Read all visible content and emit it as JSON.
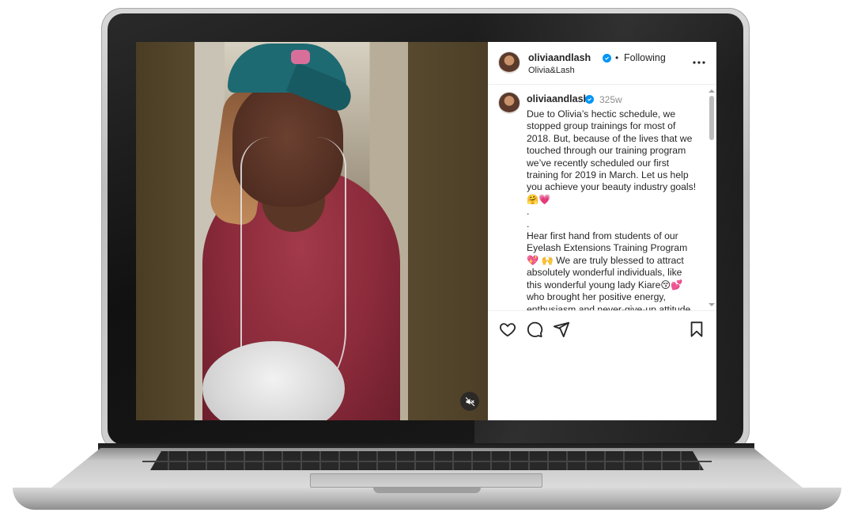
{
  "post": {
    "username": "oliviaandlash",
    "follow_status": "Following",
    "subtitle": "Olivia&Lash",
    "time_ago": "325w",
    "caption": "Due to Olivia’s hectic schedule, we stopped group trainings for most of 2018. But, because of the lives that we touched through our training program we’ve recently scheduled our first training for 2019 in March. Let us help you achieve your beauty industry goals! 🤗💗\n.\n.\nHear first hand from students of our Eyelash Extensions Training Program 💖 🙌 We are truly blessed to attract absolutely wonderful individuals, like this wonderful young lady Kiare😚💕 who brought her positive energy, enthusiasm and never-give-up attitude"
  },
  "video": {
    "muted_icon": "speaker-muted-icon"
  },
  "actions": {
    "icons": [
      "heart-icon",
      "comment-icon",
      "share-icon",
      "bookmark-icon"
    ]
  },
  "colors": {
    "verified": "#0095f6",
    "text": "#262626",
    "muted_text": "#8e8e8e"
  }
}
